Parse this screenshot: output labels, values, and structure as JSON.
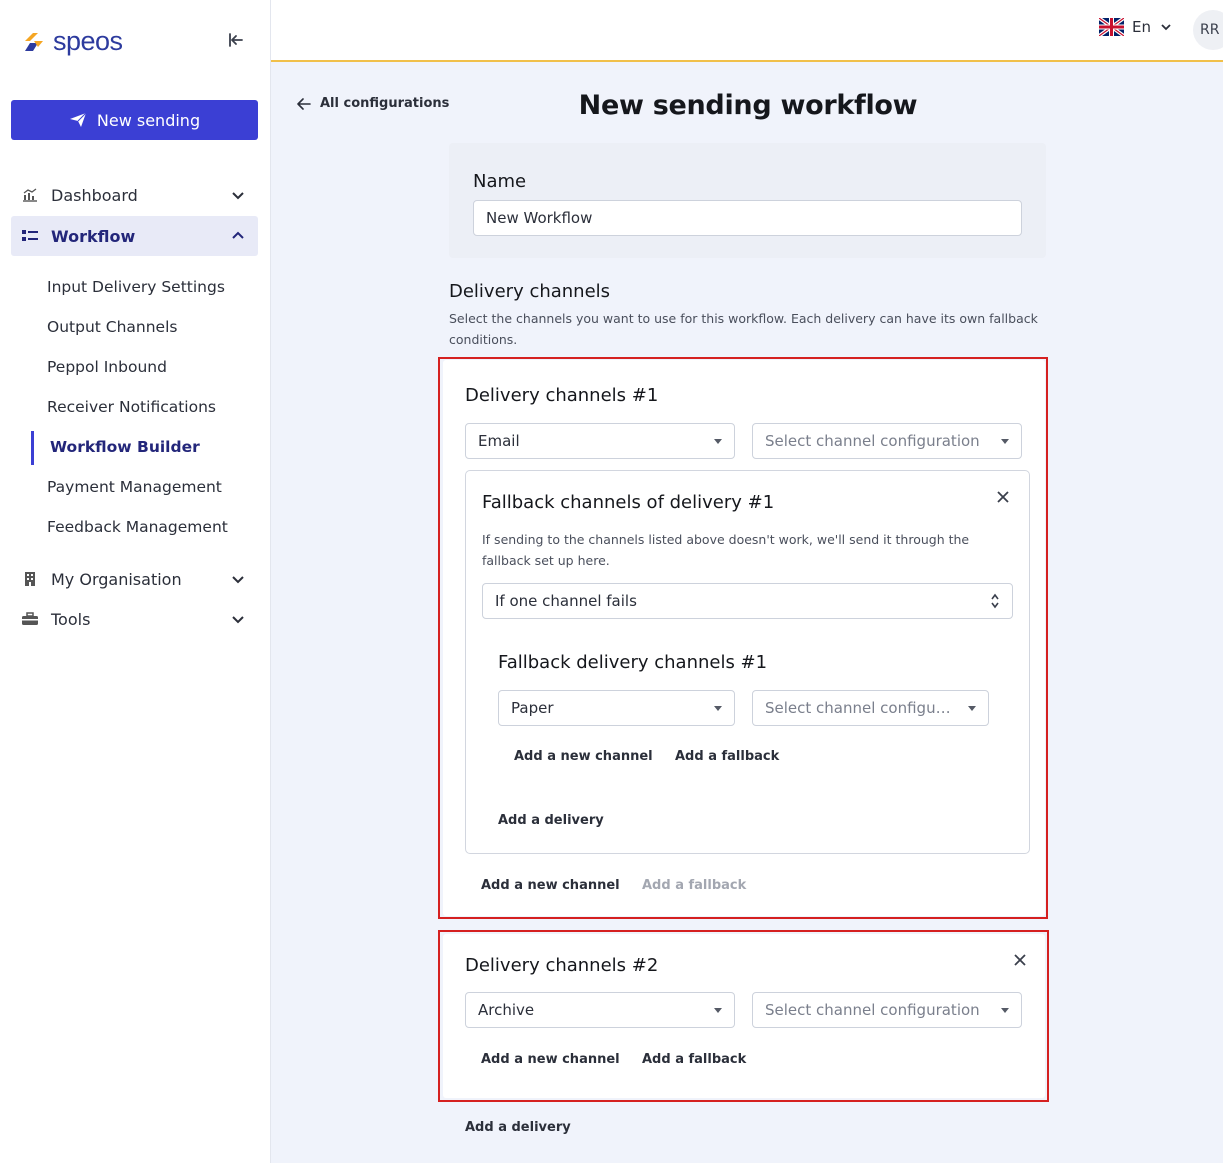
{
  "brand": {
    "name": "speos"
  },
  "sidebar": {
    "new_sending_label": "New sending",
    "items": [
      {
        "label": "Dashboard",
        "icon": "chart-icon"
      },
      {
        "label": "Workflow",
        "icon": "workflow-icon"
      },
      {
        "label": "My Organisation",
        "icon": "building-icon"
      },
      {
        "label": "Tools",
        "icon": "toolbox-icon"
      }
    ],
    "workflow_sub": [
      {
        "label": "Input Delivery Settings"
      },
      {
        "label": "Output Channels"
      },
      {
        "label": "Peppol Inbound"
      },
      {
        "label": "Receiver Notifications"
      },
      {
        "label": "Workflow Builder"
      },
      {
        "label": "Payment Management"
      },
      {
        "label": "Feedback Management"
      }
    ]
  },
  "topbar": {
    "language": "En",
    "avatar_initials": "RR"
  },
  "main": {
    "back_link": "All configurations",
    "title": "New sending workflow",
    "name_label": "Name",
    "name_value": "New Workflow",
    "delivery_heading": "Delivery channels",
    "delivery_description": "Select the channels you want to use for this workflow. Each delivery can have its own fallback conditions.",
    "delivery1": {
      "title": "Delivery channels #1",
      "channel": "Email",
      "config_placeholder": "Select channel configuration",
      "fallback": {
        "title": "Fallback channels of delivery #1",
        "description": "If sending to the channels listed above doesn't work, we'll send it through the fallback set up here.",
        "condition": "If one channel fails",
        "sub_title": "Fallback delivery channels #1",
        "channel": "Paper",
        "config_placeholder": "Select channel configurat...",
        "add_channel": "Add a new channel",
        "add_fallback": "Add a fallback",
        "add_delivery": "Add a delivery"
      },
      "add_channel": "Add a new channel",
      "add_fallback": "Add a fallback"
    },
    "delivery2": {
      "title": "Delivery channels #2",
      "channel": "Archive",
      "config_placeholder": "Select channel configuration",
      "add_channel": "Add a new channel",
      "add_fallback": "Add a fallback"
    },
    "add_delivery": "Add a delivery"
  },
  "colors": {
    "accent": "#3b3fd4",
    "highlight_border": "#d52020",
    "topbar_border": "#f1c04a"
  }
}
